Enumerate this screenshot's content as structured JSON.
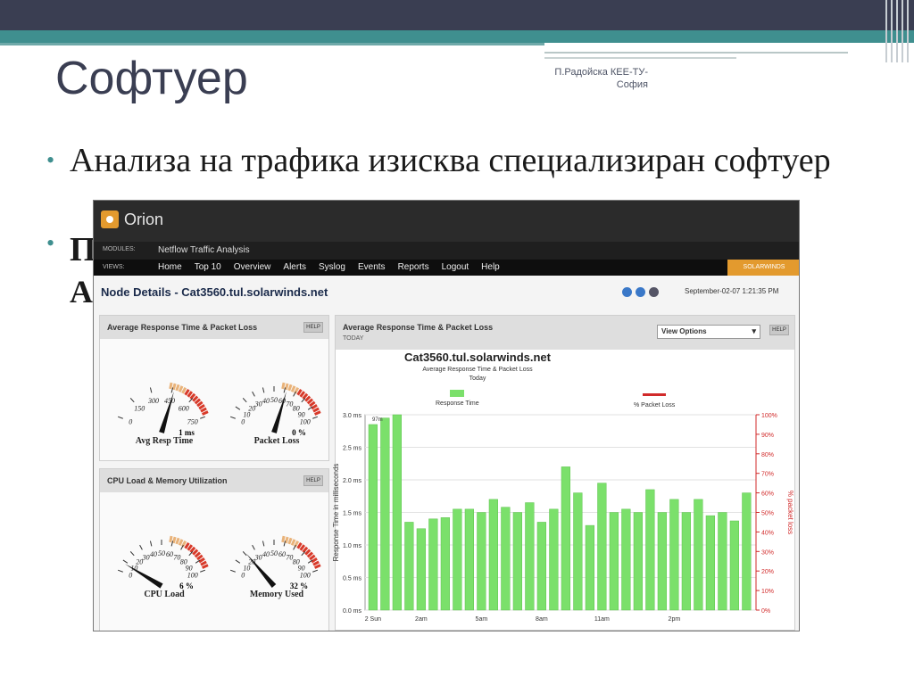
{
  "slide": {
    "title": "Софтуер",
    "author_line1": "П.Радойска КЕЕ-ТУ-",
    "author_line2": "София",
    "bullet1": "Анализа на трафика изисква специализиран софтуер",
    "bullet2_initial": "П",
    "bullet2_line2_initial": "А"
  },
  "colors": {
    "accent": "#3f8f8f",
    "dark": "#3a3e52",
    "orion_orange": "#e39a2e",
    "bar_green": "#7be06b",
    "loss_red": "#d12a2a"
  },
  "orion": {
    "app_name": "Orion",
    "modules_label": "MODULES:",
    "modules_value": "Netflow Traffic Analysis",
    "views_label": "VIEWS:",
    "nav": [
      "Home",
      "Top 10",
      "Overview",
      "Alerts",
      "Syslog",
      "Events",
      "Reports",
      "Logout",
      "Help"
    ],
    "brand": "SOLARWINDS",
    "node_title": "Node Details - Cat3560.tul.solarwinds.net",
    "datetime": "September-02-07 1:21:35 PM",
    "help": "HELP",
    "panel_resp": "Average Response Time & Packet Loss",
    "panel_cpu": "CPU Load & Memory Utilization",
    "chart_panel_title": "Average Response Time & Packet Loss",
    "chart_panel_sub": "TODAY",
    "view_options": "View Options",
    "gauges": [
      {
        "label": "Avg Resp Time",
        "reading": "1 ms",
        "value": 1,
        "max": 750,
        "ticks": [
          "0",
          "150",
          "300",
          "450",
          "600",
          "750"
        ]
      },
      {
        "label": "Packet Loss",
        "reading": "0 %",
        "value": 0,
        "max": 100,
        "ticks": [
          "0",
          "10",
          "20",
          "30",
          "40",
          "50",
          "60",
          "70",
          "80",
          "90",
          "100"
        ]
      },
      {
        "label": "CPU Load",
        "reading": "6 %",
        "value": 6,
        "max": 100,
        "ticks": [
          "0",
          "10",
          "20",
          "30",
          "40",
          "50",
          "60",
          "70",
          "80",
          "90",
          "100"
        ]
      },
      {
        "label": "Memory Used",
        "reading": "32 %",
        "value": 32,
        "max": 100,
        "ticks": [
          "0",
          "10",
          "20",
          "30",
          "40",
          "50",
          "60",
          "70",
          "80",
          "90",
          "100"
        ]
      }
    ]
  },
  "chart_data": {
    "type": "bar",
    "title": "Cat3560.tul.solarwinds.net",
    "subtitle": "Average Response Time & Packet Loss",
    "subtitle2": "Today",
    "ylabel": "Response Time in milliseconds",
    "y2label": "% packet loss",
    "ylim": [
      0,
      3.0
    ],
    "y2lim": [
      0,
      100
    ],
    "yticks": [
      "0.0 ms",
      "0.5 ms",
      "1.0 ms",
      "1.5 ms",
      "2.0 ms",
      "2.5 ms",
      "3.0 ms"
    ],
    "y2ticks": [
      "0%",
      "10%",
      "20%",
      "30%",
      "40%",
      "50%",
      "60%",
      "70%",
      "80%",
      "90%",
      "100%"
    ],
    "xticks": [
      "2 Sun",
      "2am",
      "5am",
      "8am",
      "11am",
      "2pm"
    ],
    "peak_label": "97m",
    "series": [
      {
        "name": "Response Time",
        "values": [
          2.85,
          2.95,
          3.0,
          1.35,
          1.25,
          1.4,
          1.42,
          1.55,
          1.55,
          1.5,
          1.7,
          1.58,
          1.5,
          1.65,
          1.35,
          1.55,
          2.2,
          1.8,
          1.3,
          1.95,
          1.5,
          1.55,
          1.5,
          1.85,
          1.5,
          1.7,
          1.5,
          1.7,
          1.45,
          1.5,
          1.37,
          1.8
        ]
      },
      {
        "name": "% Packet Loss",
        "values": [
          0,
          0,
          0,
          0,
          0,
          0,
          0,
          0,
          0,
          0,
          0,
          0,
          0,
          0,
          0,
          0,
          0,
          0,
          0,
          0,
          0,
          0,
          0,
          0,
          0,
          0,
          0,
          0,
          0,
          0,
          0,
          0
        ]
      }
    ]
  }
}
